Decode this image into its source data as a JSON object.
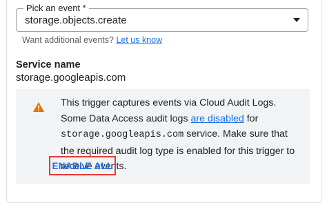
{
  "event": {
    "label": "Pick an event *",
    "value": "storage.objects.create",
    "helper_text": "Want additional events?",
    "helper_link": "Let us know"
  },
  "service": {
    "heading": "Service name",
    "value": "storage.googleapis.com"
  },
  "warning": {
    "icon": "warning-icon",
    "text_1": "This trigger captures events via Cloud Audit Logs. Some Data Access audit logs ",
    "link": "are disabled",
    "text_2": " for ",
    "service_code": "storage.googleapis.com",
    "text_3": " service. Make sure that the required audit log type is enabled for this trigger to receive events.",
    "button_label": "ENABLE ALL"
  },
  "colors": {
    "accent": "#1a73e8",
    "warning_icon": "#e37400",
    "highlight_border": "#e53935",
    "warning_bg": "#f1f3f4"
  }
}
